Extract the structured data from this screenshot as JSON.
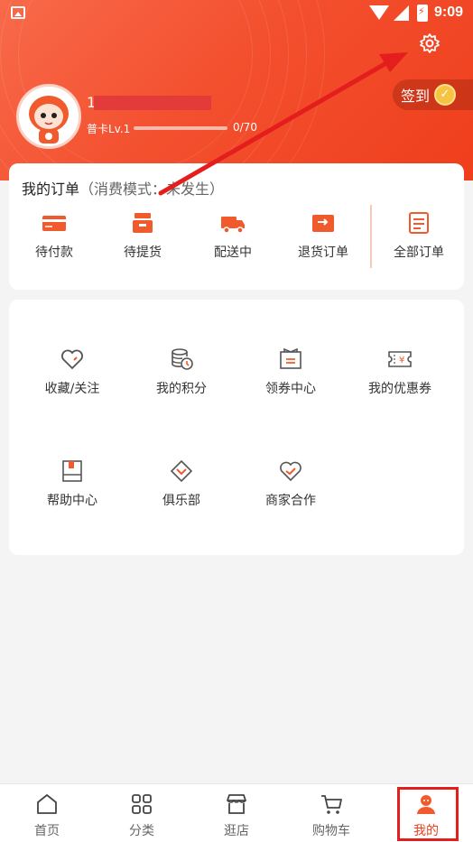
{
  "status_bar": {
    "time": "9:09"
  },
  "profile": {
    "username": "1",
    "level": "普卡Lv.1",
    "points_text": "0/70",
    "progress_fraction": 0.0
  },
  "signin": {
    "label": "签到"
  },
  "orders": {
    "title": "我的订单",
    "subtitle": "（消费模式：未发生）",
    "items": [
      {
        "label": "待付款",
        "icon": "card-icon"
      },
      {
        "label": "待提货",
        "icon": "package-icon"
      },
      {
        "label": "配送中",
        "icon": "truck-icon"
      },
      {
        "label": "退货订单",
        "icon": "wallet-return-icon"
      },
      {
        "label": "全部订单",
        "icon": "list-icon"
      }
    ]
  },
  "features": {
    "items": [
      {
        "label": "收藏/关注",
        "icon": "heart-icon"
      },
      {
        "label": "我的积分",
        "icon": "coins-icon"
      },
      {
        "label": "领券中心",
        "icon": "coupon-book-icon"
      },
      {
        "label": "我的优惠券",
        "icon": "yen-ticket-icon"
      },
      {
        "label": "帮助中心",
        "icon": "help-book-icon"
      },
      {
        "label": "俱乐部",
        "icon": "diamond-icon"
      },
      {
        "label": "商家合作",
        "icon": "handshake-heart-icon"
      }
    ]
  },
  "bottom_nav": {
    "items": [
      {
        "label": "首页",
        "icon": "home-icon"
      },
      {
        "label": "分类",
        "icon": "grid-icon"
      },
      {
        "label": "逛店",
        "icon": "store-icon"
      },
      {
        "label": "购物车",
        "icon": "cart-icon"
      },
      {
        "label": "我的",
        "icon": "profile-icon"
      }
    ],
    "active_index": 4
  },
  "colors": {
    "accent": "#ef3e1c",
    "annotation": "#e41d1d"
  }
}
